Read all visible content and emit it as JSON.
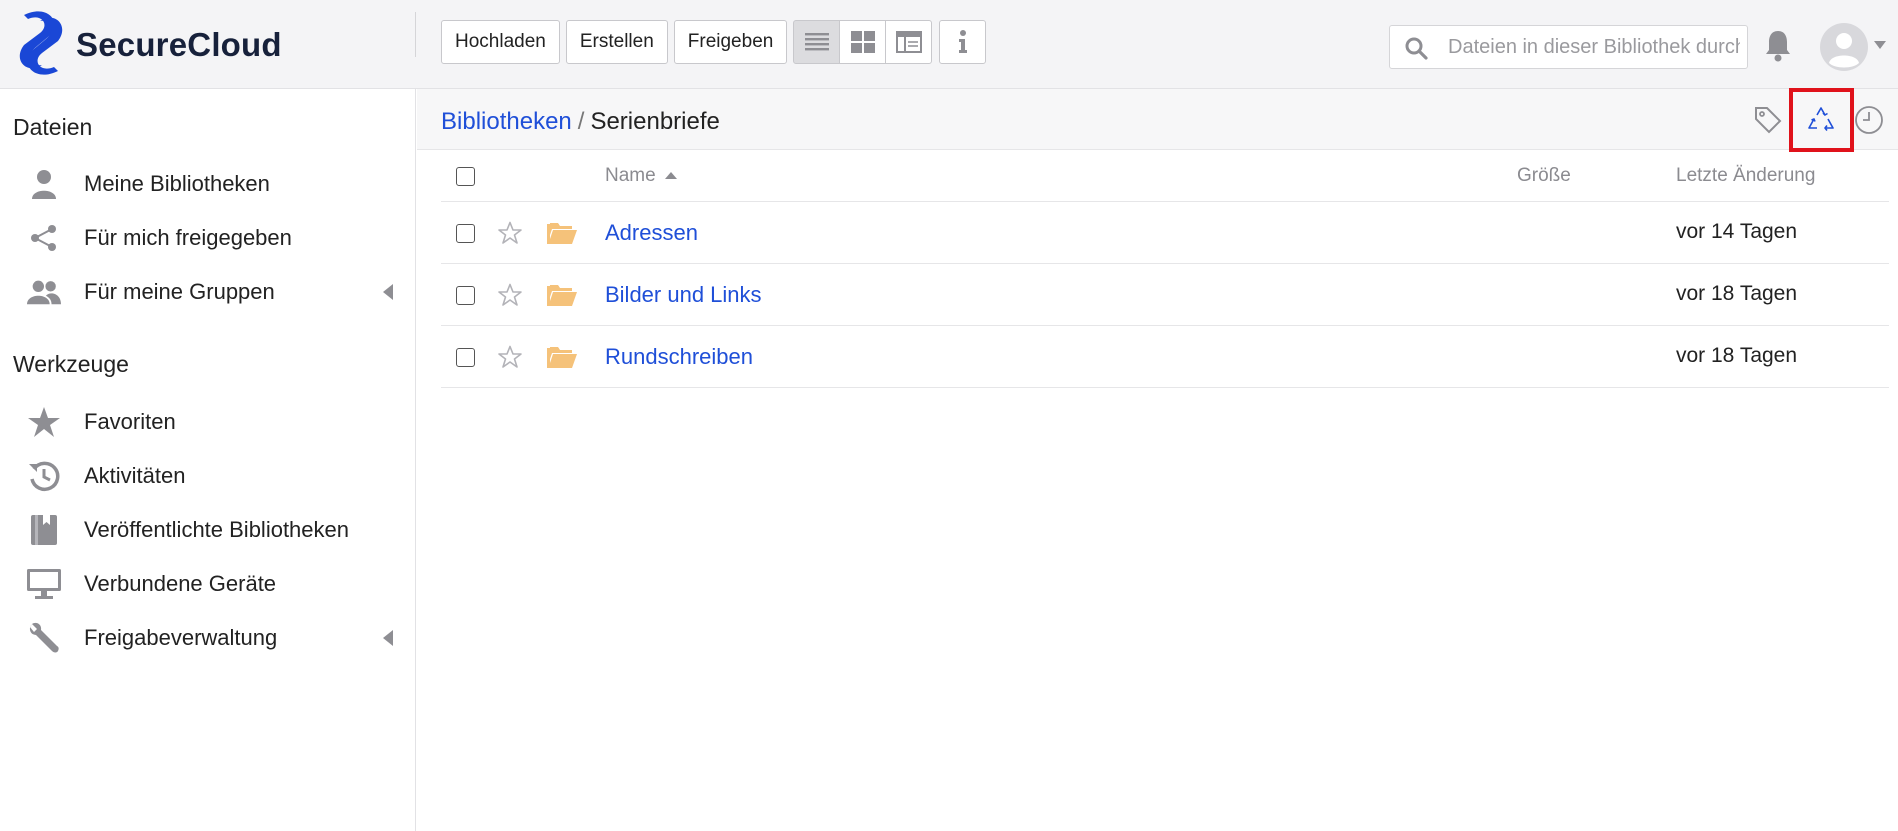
{
  "app": {
    "brand_first": "Secure",
    "brand_second": "Cloud",
    "brand_color": "#1a47d6"
  },
  "toolbar": {
    "upload_label": "Hochladen",
    "create_label": "Erstellen",
    "share_label": "Freigeben",
    "view_modes": [
      "list-view-icon",
      "grid-view-icon",
      "column-view-icon"
    ],
    "active_view": "list-view-icon",
    "info_icon": "info-icon"
  },
  "search": {
    "placeholder": "Dateien in dieser Bibliothek durchsuchen",
    "value": ""
  },
  "sidebar": {
    "files_heading": "Dateien",
    "files_items": [
      {
        "label": "Meine Bibliotheken",
        "icon": "user-icon"
      },
      {
        "label": "Für mich freigegeben",
        "icon": "share-icon"
      },
      {
        "label": "Für meine Gruppen",
        "icon": "group-icon",
        "expandable": true
      }
    ],
    "tools_heading": "Werkzeuge",
    "tools_items": [
      {
        "label": "Favoriten",
        "icon": "star-icon"
      },
      {
        "label": "Aktivitäten",
        "icon": "history-icon"
      },
      {
        "label": "Veröffentlichte Bibliotheken",
        "icon": "book-icon"
      },
      {
        "label": "Verbundene Geräte",
        "icon": "monitor-icon"
      },
      {
        "label": "Freigabeverwaltung",
        "icon": "wrench-icon",
        "expandable": true
      }
    ]
  },
  "breadcrumb": {
    "root": "Bibliotheken",
    "separator": "/",
    "current": "Serienbriefe"
  },
  "pathbar_icons": [
    "tag-icon",
    "recycle-bin-icon",
    "history-clock-icon"
  ],
  "table": {
    "columns": {
      "name": "Name",
      "size": "Größe",
      "modified": "Letzte Änderung"
    },
    "sort": {
      "column": "name",
      "direction": "ascending"
    },
    "rows": [
      {
        "name": "Adressen",
        "size": "",
        "modified": "vor 14 Tagen"
      },
      {
        "name": "Bilder und Links",
        "size": "",
        "modified": "vor 18 Tagen"
      },
      {
        "name": "Rundschreiben",
        "size": "",
        "modified": "vor 18 Tagen"
      }
    ]
  },
  "colors": {
    "link": "#1f4fd8",
    "highlight": "#e0121b",
    "folder": "#f5c27a",
    "icon_gray": "#8e8e93"
  }
}
